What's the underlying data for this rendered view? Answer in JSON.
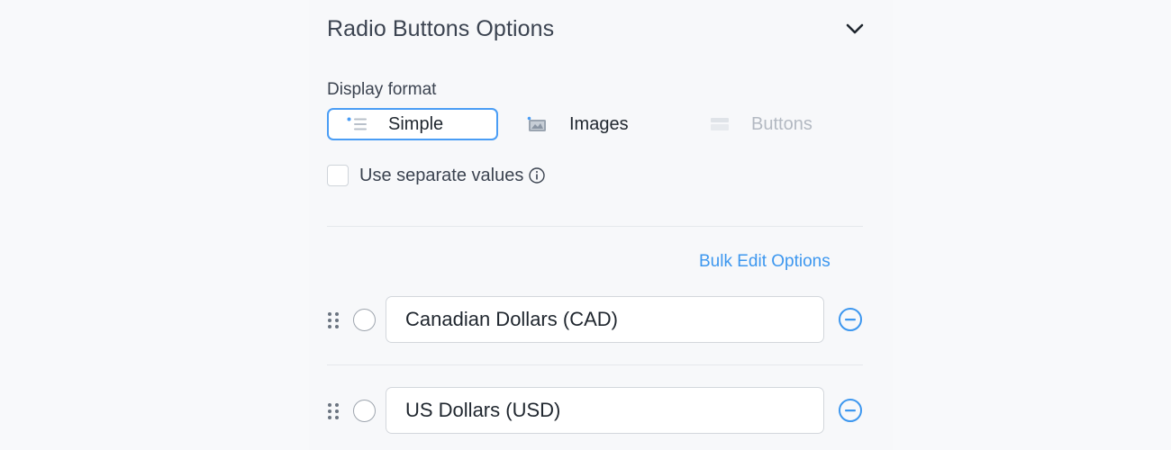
{
  "panel": {
    "title": "Radio Buttons Options",
    "toggle_icon": "chevron-down-icon"
  },
  "display_format": {
    "label": "Display format",
    "options": [
      {
        "label": "Simple",
        "icon": "list-icon",
        "selected": true
      },
      {
        "label": "Images",
        "icon": "image-icon",
        "selected": false
      },
      {
        "label": "Buttons",
        "icon": "buttons-icon",
        "selected": false,
        "disabled": true
      }
    ]
  },
  "separate_values": {
    "label": "Use separate values",
    "checked": false,
    "icon": "info-icon"
  },
  "bulk_edit": {
    "label": "Bulk Edit Options"
  },
  "options": [
    {
      "value": "Canadian Dollars (CAD)",
      "checked": false
    },
    {
      "value": "US Dollars (USD)",
      "checked": false
    }
  ],
  "colors": {
    "accent": "#3d97ef",
    "selected_border": "#4a9df5",
    "disabled_text": "#b3b9c2"
  }
}
